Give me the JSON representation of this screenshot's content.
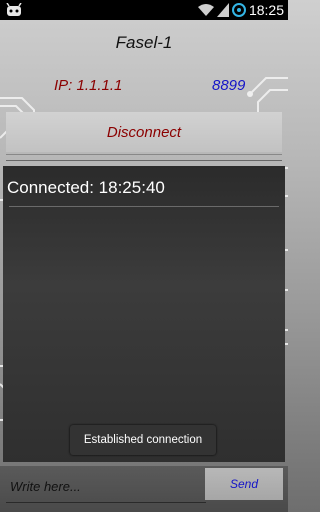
{
  "status_bar": {
    "time": "18:25"
  },
  "header": {
    "title": "Fasel-1"
  },
  "connection": {
    "ip_label": "IP: 1.1.1.1",
    "port": "8899",
    "disconnect_label": "Disconnect"
  },
  "log": {
    "lines": [
      "Connected: 18:25:40"
    ]
  },
  "toast": {
    "text": "Established connection"
  },
  "composer": {
    "placeholder": "Write here...",
    "send_label": "Send"
  },
  "colors": {
    "ip": "#8b0000",
    "port": "#1414c8",
    "disconnect": "#8b0000",
    "send": "#1414c8"
  }
}
